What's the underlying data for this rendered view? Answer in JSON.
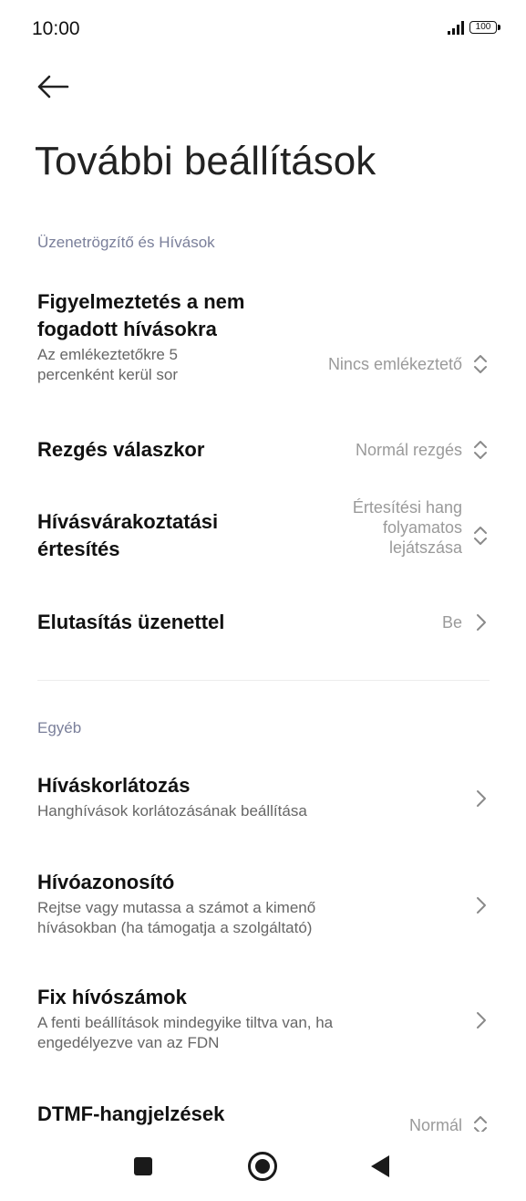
{
  "status": {
    "time": "10:00",
    "battery": "100"
  },
  "title": "További beállítások",
  "sections": {
    "calls": {
      "header": "Üzenetrögzítő és Hívások"
    },
    "other": {
      "header": "Egyéb"
    }
  },
  "items": {
    "missed": {
      "title_line1": "Figyelmeztetés a nem",
      "title_line2": "fogadott hívásokra",
      "sub_line1": "Az emlékeztetőkre 5",
      "sub_line2": "percenként kerül sor",
      "value": "Nincs emlékeztető"
    },
    "vibrate": {
      "title": "Rezgés válaszkor",
      "value": "Normál rezgés"
    },
    "waiting": {
      "title_line1": "Hívásvárakoztatási",
      "title_line2": "értesítés",
      "value_line1": "Értesítési hang",
      "value_line2": "folyamatos",
      "value_line3": "lejátszása"
    },
    "reject": {
      "title": "Elutasítás üzenettel",
      "value": "Be"
    },
    "barring": {
      "title": "Híváskorlátozás",
      "sub": "Hanghívások korlátozásának beállítása"
    },
    "callerid": {
      "title": "Hívóazonosító",
      "sub_line1": "Rejtse vagy mutassa a számot a kimenő",
      "sub_line2": "hívásokban (ha támogatja a szolgáltató)"
    },
    "fdn": {
      "title": "Fix hívószámok",
      "sub_line1": "A fenti beállítások mindegyike tiltva van, ha",
      "sub_line2": "engedélyezve van az FDN"
    },
    "dtmf": {
      "title": "DTMF-hangjelzések",
      "value": "Normál"
    }
  },
  "icons": {
    "back": "arrow-left-icon",
    "updown": "chevron-up-down-icon",
    "right": "chevron-right-icon"
  }
}
